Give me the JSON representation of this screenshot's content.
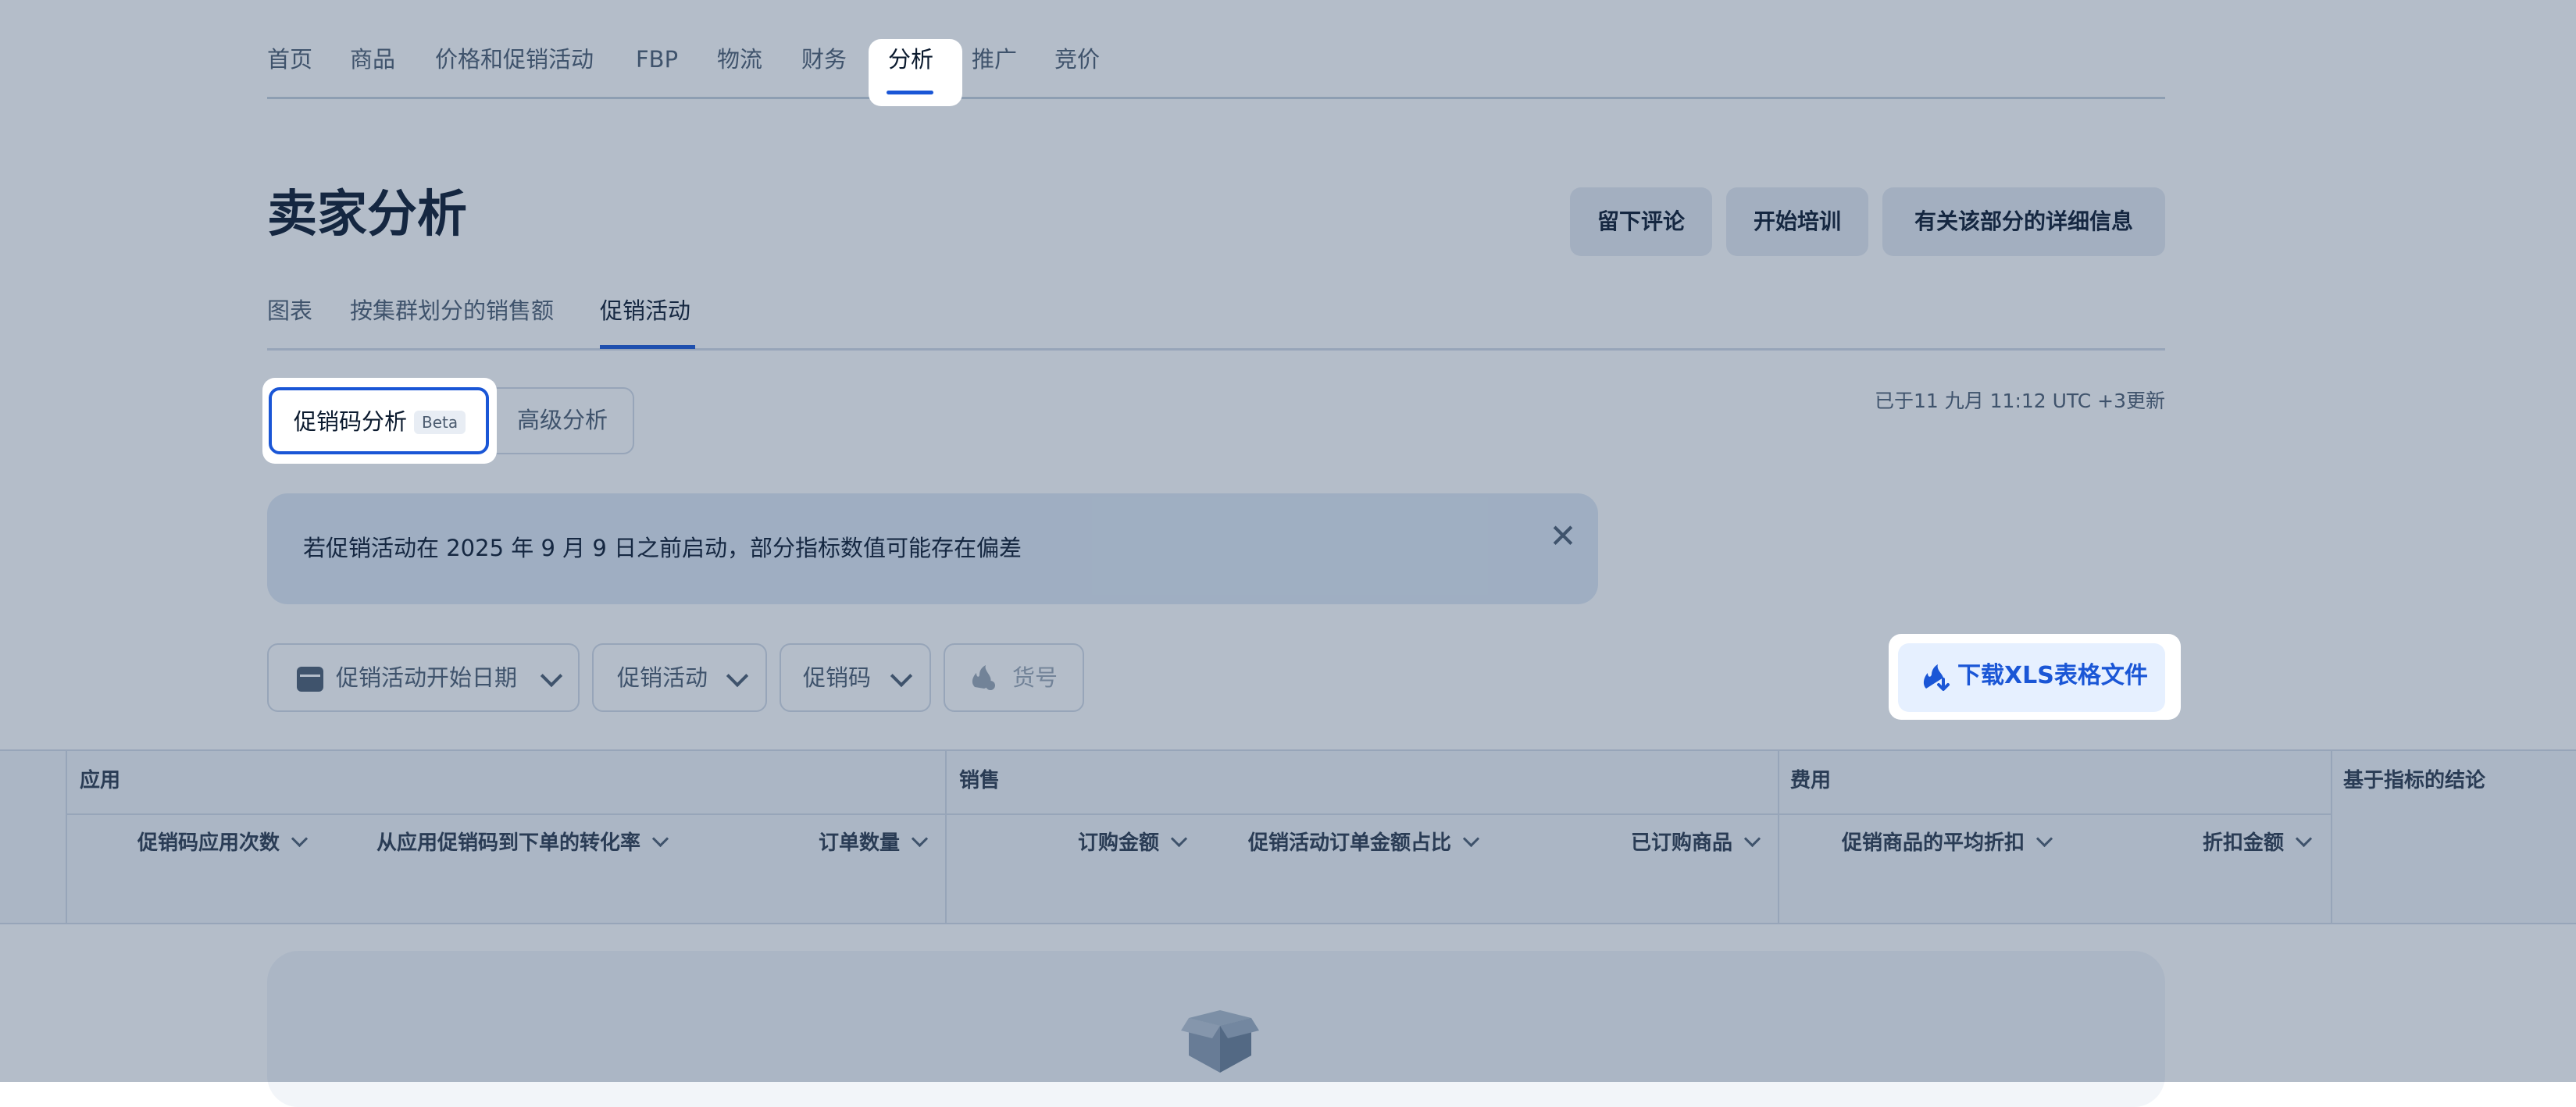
{
  "nav": {
    "items": [
      "首页",
      "商品",
      "价格和促销活动",
      "FBP",
      "物流",
      "财务",
      "分析",
      "推广",
      "竞价"
    ],
    "active": "分析"
  },
  "header": {
    "title": "卖家分析",
    "buttons": [
      "留下评论",
      "开始培训",
      "有关该部分的详细信息"
    ]
  },
  "subtabs": {
    "items": [
      "图表",
      "按集群划分的销售额",
      "促销活动"
    ],
    "active": "促销活动"
  },
  "segmented": {
    "active_label": "促销码分析",
    "badge": "Beta",
    "other_label": "高级分析"
  },
  "updated_text": "已于11 九月 11:12 UTC +3更新",
  "banner": {
    "text": "若促销活动在 2025 年 9 月 9 日之前启动，部分指标数值可能存在偏差",
    "close_icon": "close-icon"
  },
  "filters": {
    "start_date": "促销活动开始日期",
    "promotion": "促销活动",
    "promo_code": "促销码",
    "sku": "货号",
    "download": "下载XLS表格文件"
  },
  "table": {
    "groups": {
      "application": "应用",
      "sales": "销售",
      "costs": "费用",
      "conclusion": "基于指标的结论"
    },
    "columns": {
      "code_uses": "促销码应用次数",
      "conversion": "从应用促销码到下单的转化率",
      "orders": "订单数量",
      "order_amount": "订购金额",
      "promo_share": "促销活动订单金额占比",
      "ordered_items": "已订购商品",
      "avg_discount": "促销商品的平均折扣",
      "discount_amount": "折扣金额"
    }
  },
  "colors": {
    "accent": "#1a56d6",
    "overlay": "rgba(40,66,100,0.35)"
  }
}
